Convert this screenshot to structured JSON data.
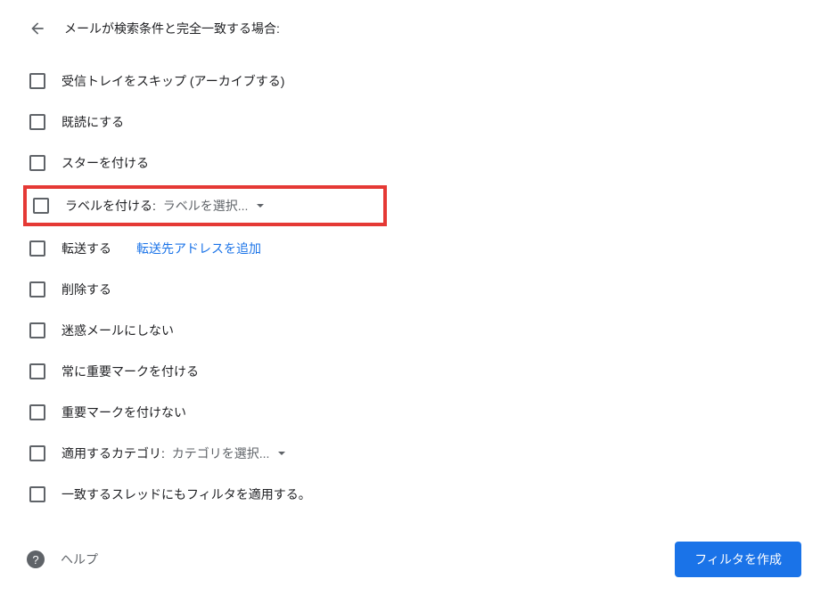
{
  "header": {
    "title": "メールが検索条件と完全一致する場合:"
  },
  "options": {
    "skip_inbox": "受信トレイをスキップ (アーカイブする)",
    "mark_read": "既読にする",
    "star": "スターを付ける",
    "apply_label_prefix": "ラベルを付ける:",
    "apply_label_dropdown": "ラベルを選択...",
    "forward": "転送する",
    "forward_link": "転送先アドレスを追加",
    "delete": "削除する",
    "never_spam": "迷惑メールにしない",
    "always_important": "常に重要マークを付ける",
    "never_important": "重要マークを付けない",
    "category_prefix": "適用するカテゴリ:",
    "category_dropdown": "カテゴリを選択...",
    "apply_to_matching": "一致するスレッドにもフィルタを適用する。"
  },
  "footer": {
    "help": "ヘルプ",
    "create_filter": "フィルタを作成"
  }
}
